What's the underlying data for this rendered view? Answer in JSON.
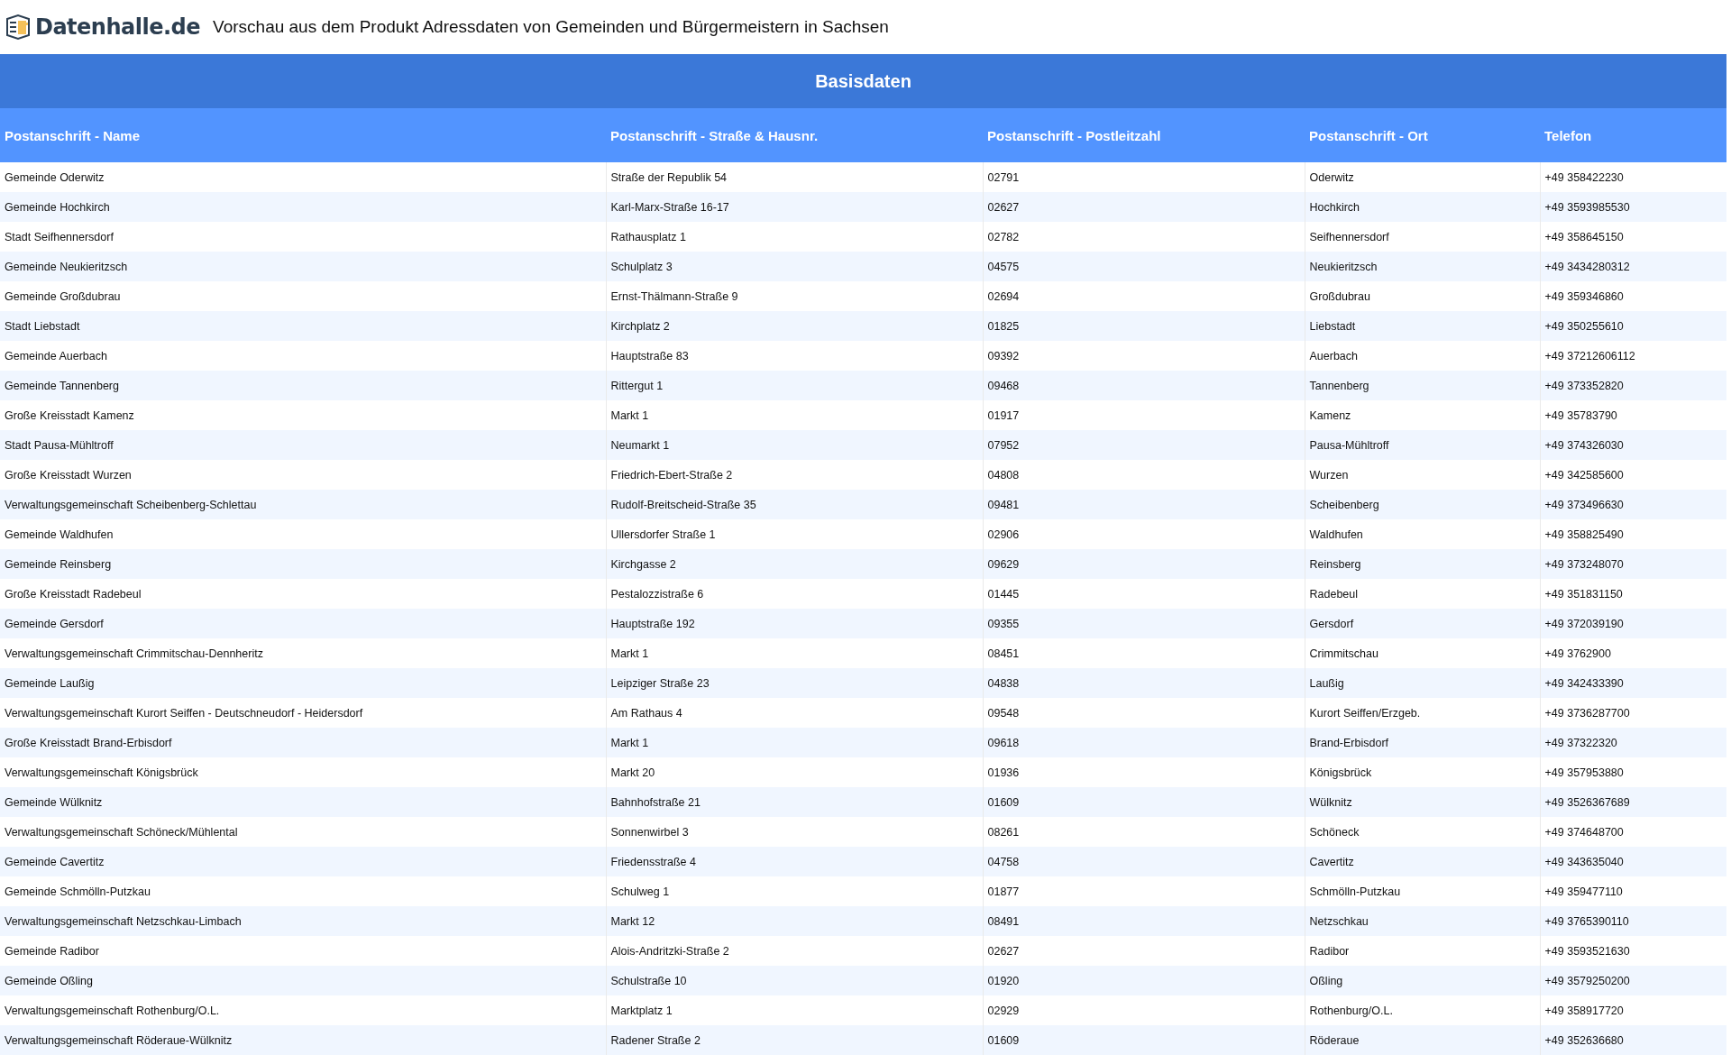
{
  "header": {
    "logo": "Datenhalle.de",
    "title": "Vorschau aus dem Produkt Adressdaten von Gemeinden und Bürgermeistern in Sachsen"
  },
  "table": {
    "caption": "Basisdaten",
    "columns": [
      "Postanschrift - Name",
      "Postanschrift - Straße & Hausnr.",
      "Postanschrift - Postleitzahl",
      "Postanschrift - Ort",
      "Telefon"
    ],
    "rows": [
      [
        "Gemeinde Oderwitz",
        "Straße der Republik 54",
        "02791",
        "Oderwitz",
        "+49 358422230"
      ],
      [
        "Gemeinde Hochkirch",
        "Karl-Marx-Straße 16-17",
        "02627",
        "Hochkirch",
        "+49 3593985530"
      ],
      [
        "Stadt Seifhennersdorf",
        "Rathausplatz 1",
        "02782",
        "Seifhennersdorf",
        "+49 358645150"
      ],
      [
        "Gemeinde Neukieritzsch",
        "Schulplatz 3",
        "04575",
        "Neukieritzsch",
        "+49 3434280312"
      ],
      [
        "Gemeinde Großdubrau",
        "Ernst-Thälmann-Straße 9",
        "02694",
        "Großdubrau",
        "+49 359346860"
      ],
      [
        "Stadt Liebstadt",
        "Kirchplatz 2",
        "01825",
        "Liebstadt",
        "+49 350255610"
      ],
      [
        "Gemeinde Auerbach",
        "Hauptstraße 83",
        "09392",
        "Auerbach",
        "+49 37212606112"
      ],
      [
        "Gemeinde Tannenberg",
        "Rittergut 1",
        "09468",
        "Tannenberg",
        "+49 373352820"
      ],
      [
        "Große Kreisstadt Kamenz",
        "Markt 1",
        "01917",
        "Kamenz",
        "+49 35783790"
      ],
      [
        "Stadt Pausa-Mühltroff",
        "Neumarkt 1",
        "07952",
        "Pausa-Mühltroff",
        "+49 374326030"
      ],
      [
        "Große Kreisstadt Wurzen",
        "Friedrich-Ebert-Straße 2",
        "04808",
        "Wurzen",
        "+49 342585600"
      ],
      [
        "Verwaltungsgemeinschaft Scheibenberg-Schlettau",
        "Rudolf-Breitscheid-Straße 35",
        "09481",
        "Scheibenberg",
        "+49 373496630"
      ],
      [
        "Gemeinde Waldhufen",
        "Ullersdorfer Straße 1",
        "02906",
        "Waldhufen",
        "+49 358825490"
      ],
      [
        "Gemeinde Reinsberg",
        "Kirchgasse 2",
        "09629",
        "Reinsberg",
        "+49 373248070"
      ],
      [
        "Große Kreisstadt Radebeul",
        "Pestalozzistraße 6",
        "01445",
        "Radebeul",
        "+49 351831150"
      ],
      [
        "Gemeinde Gersdorf",
        "Hauptstraße 192",
        "09355",
        "Gersdorf",
        "+49 372039190"
      ],
      [
        "Verwaltungsgemeinschaft Crimmitschau-Dennheritz",
        "Markt 1",
        "08451",
        "Crimmitschau",
        "+49 3762900"
      ],
      [
        "Gemeinde Laußig",
        "Leipziger Straße 23",
        "04838",
        "Laußig",
        "+49 342433390"
      ],
      [
        "Verwaltungsgemeinschaft Kurort Seiffen - Deutschneudorf - Heidersdorf",
        "Am Rathaus 4",
        "09548",
        "Kurort Seiffen/Erzgeb.",
        "+49 3736287700"
      ],
      [
        "Große Kreisstadt Brand-Erbisdorf",
        "Markt 1",
        "09618",
        "Brand-Erbisdorf",
        "+49 37322320"
      ],
      [
        "Verwaltungsgemeinschaft Königsbrück",
        "Markt 20",
        "01936",
        "Königsbrück",
        "+49 357953880"
      ],
      [
        "Gemeinde Wülknitz",
        "Bahnhofstraße 21",
        "01609",
        "Wülknitz",
        "+49 3526367689"
      ],
      [
        "Verwaltungsgemeinschaft Schöneck/Mühlental",
        "Sonnenwirbel 3",
        "08261",
        "Schöneck",
        "+49 374648700"
      ],
      [
        "Gemeinde Cavertitz",
        "Friedensstraße 4",
        "04758",
        "Cavertitz",
        "+49 343635040"
      ],
      [
        "Gemeinde Schmölln-Putzkau",
        "Schulweg 1",
        "01877",
        "Schmölln-Putzkau",
        "+49 359477110"
      ],
      [
        "Verwaltungsgemeinschaft Netzschkau-Limbach",
        "Markt 12",
        "08491",
        "Netzschkau",
        "+49 3765390110"
      ],
      [
        "Gemeinde Radibor",
        "Alois-Andritzki-Straße 2",
        "02627",
        "Radibor",
        "+49 3593521630"
      ],
      [
        "Gemeinde Oßling",
        "Schulstraße 10",
        "01920",
        "Oßling",
        "+49 3579250200"
      ],
      [
        "Verwaltungsgemeinschaft Rothenburg/O.L.",
        "Marktplatz 1",
        "02929",
        "Rothenburg/O.L.",
        "+49 358917720"
      ],
      [
        "Verwaltungsgemeinschaft Röderaue-Wülknitz",
        "Radener Straße 2",
        "01609",
        "Röderaue",
        "+49 352636680"
      ]
    ]
  }
}
